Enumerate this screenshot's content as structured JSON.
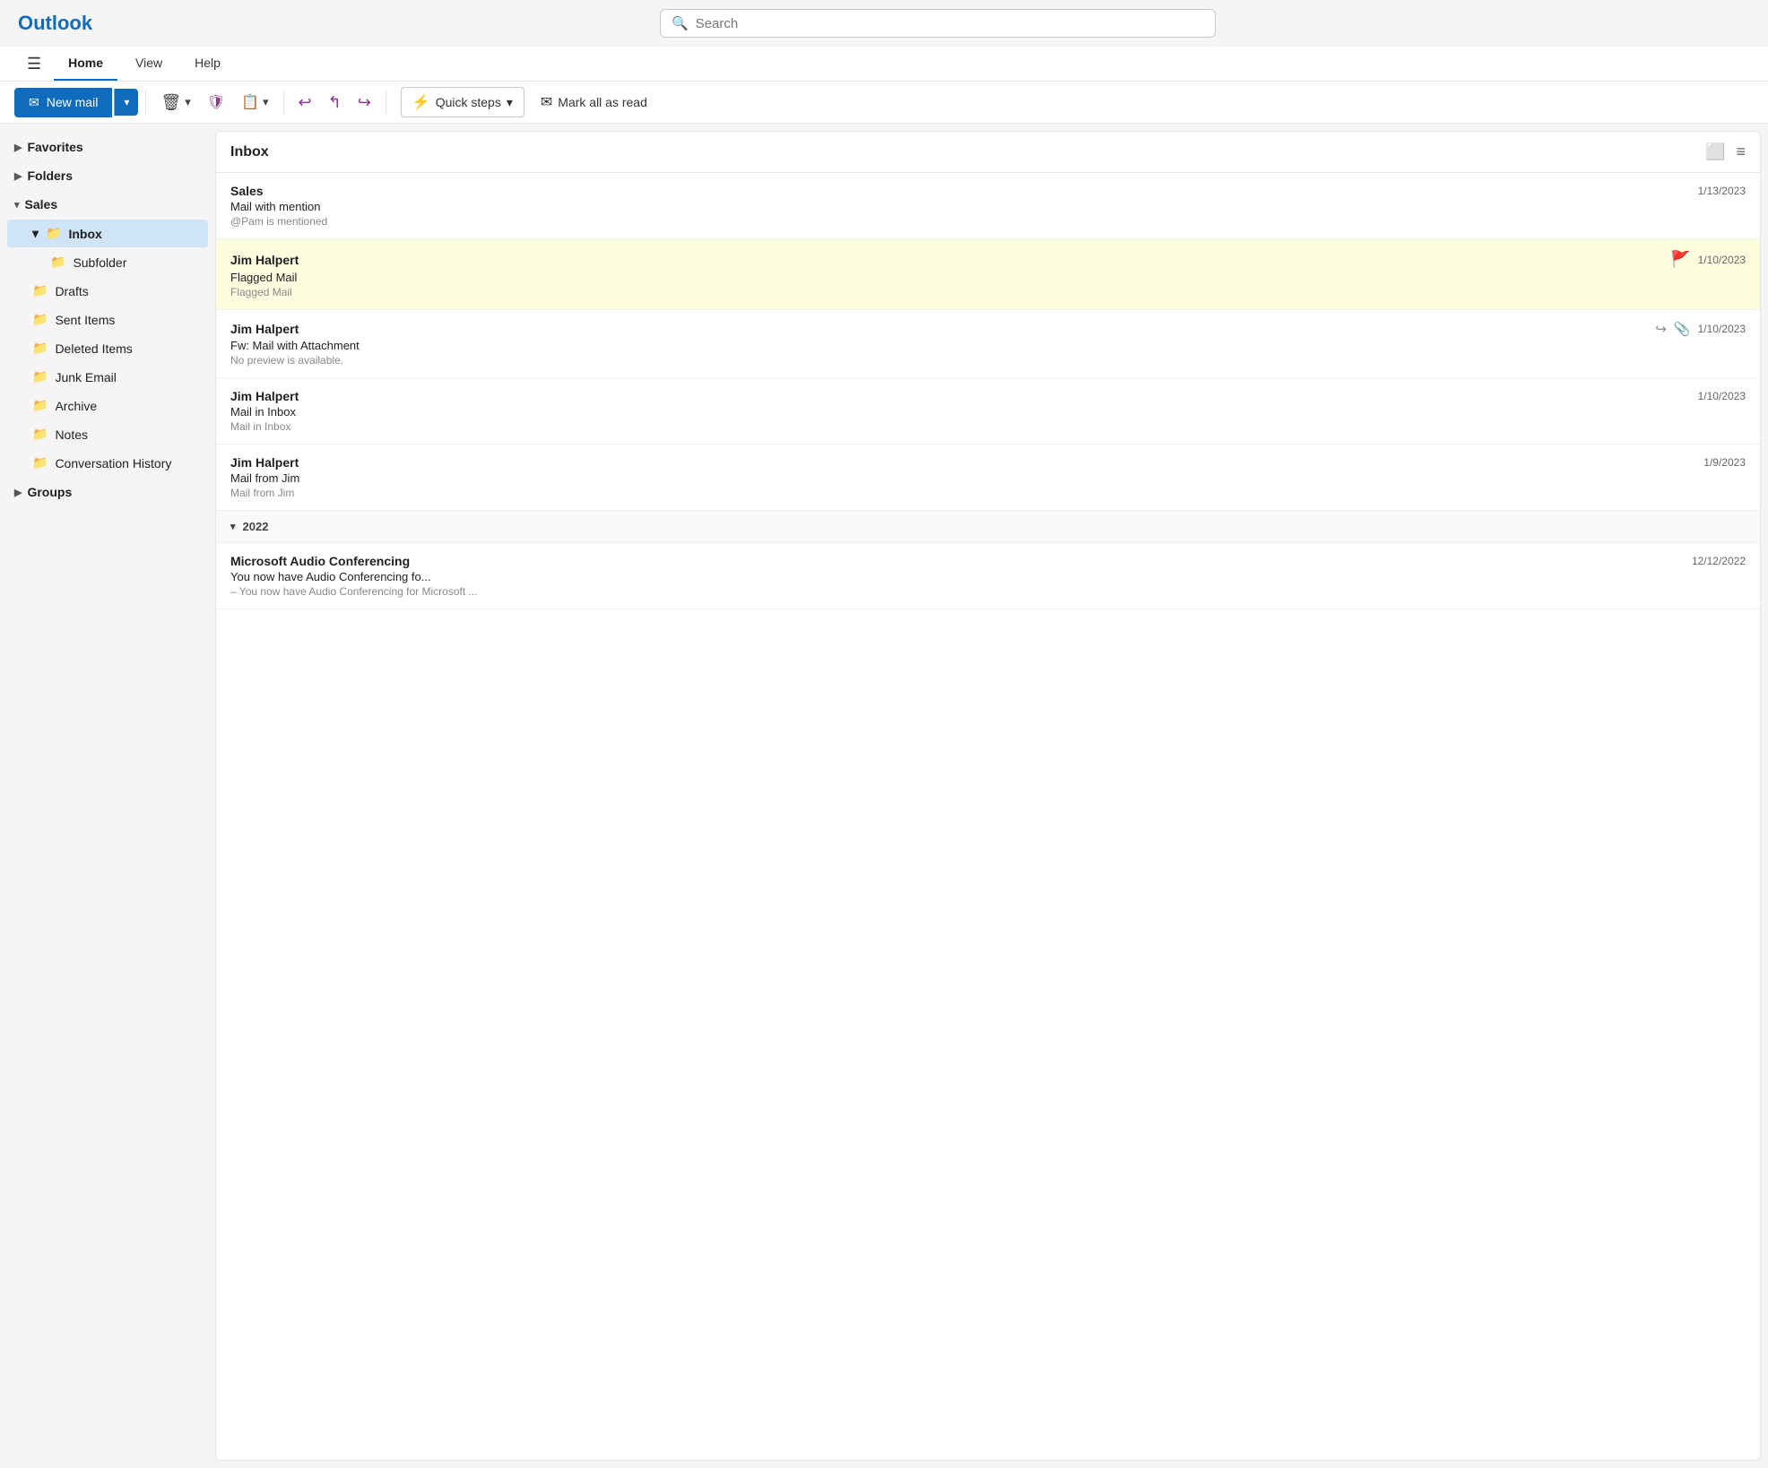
{
  "app": {
    "logo": "Outlook",
    "search_placeholder": "Search"
  },
  "navbar": {
    "hamburger": "☰",
    "tabs": [
      {
        "label": "Home",
        "active": true
      },
      {
        "label": "View",
        "active": false
      },
      {
        "label": "Help",
        "active": false
      }
    ]
  },
  "toolbar": {
    "new_mail_label": "New mail",
    "new_mail_dropdown_icon": "▾",
    "delete_icon": "🗑",
    "delete_dropdown": "▾",
    "shield_icon": "🛡",
    "move_icon": "⇒",
    "move_dropdown": "▾",
    "reply_icon": "↩",
    "reply_all_icon": "↩↩",
    "forward_icon": "↪",
    "quick_steps_label": "Quick steps",
    "quick_steps_icon": "⚡",
    "quick_steps_dropdown": "▾",
    "mark_all_read_icon": "✉",
    "mark_all_read_label": "Mark all as read"
  },
  "sidebar": {
    "favorites_label": "Favorites",
    "folders_label": "Folders",
    "sales_label": "Sales",
    "inbox_label": "Inbox",
    "subfolder_label": "Subfolder",
    "drafts_label": "Drafts",
    "sent_items_label": "Sent Items",
    "deleted_items_label": "Deleted Items",
    "junk_email_label": "Junk Email",
    "archive_label": "Archive",
    "notes_label": "Notes",
    "conversation_history_label": "Conversation History",
    "groups_label": "Groups"
  },
  "inbox": {
    "title": "Inbox",
    "emails": [
      {
        "sender": "Sales",
        "subject": "Mail with mention",
        "preview": "@Pam is mentioned",
        "date": "1/13/2023",
        "flagged": false,
        "forwarded": false,
        "attachment": false
      },
      {
        "sender": "Jim Halpert",
        "subject": "Flagged Mail",
        "preview": "Flagged Mail",
        "date": "1/10/2023",
        "flagged": true,
        "forwarded": false,
        "attachment": false
      },
      {
        "sender": "Jim Halpert",
        "subject": "Fw: Mail with Attachment",
        "preview": "No preview is available.",
        "date": "1/10/2023",
        "flagged": false,
        "forwarded": true,
        "attachment": true
      },
      {
        "sender": "Jim Halpert",
        "subject": "Mail in Inbox",
        "preview": "Mail in Inbox",
        "date": "1/10/2023",
        "flagged": false,
        "forwarded": false,
        "attachment": false
      },
      {
        "sender": "Jim Halpert",
        "subject": "Mail from Jim",
        "preview": "Mail from Jim",
        "date": "1/9/2023",
        "flagged": false,
        "forwarded": false,
        "attachment": false
      }
    ],
    "section_2022": "2022",
    "email_2022": {
      "sender": "Microsoft Audio Conferencing",
      "subject": "You now have Audio Conferencing fo...",
      "preview": "– You now have Audio Conferencing for Microsoft ...",
      "date": "12/12/2022"
    }
  }
}
